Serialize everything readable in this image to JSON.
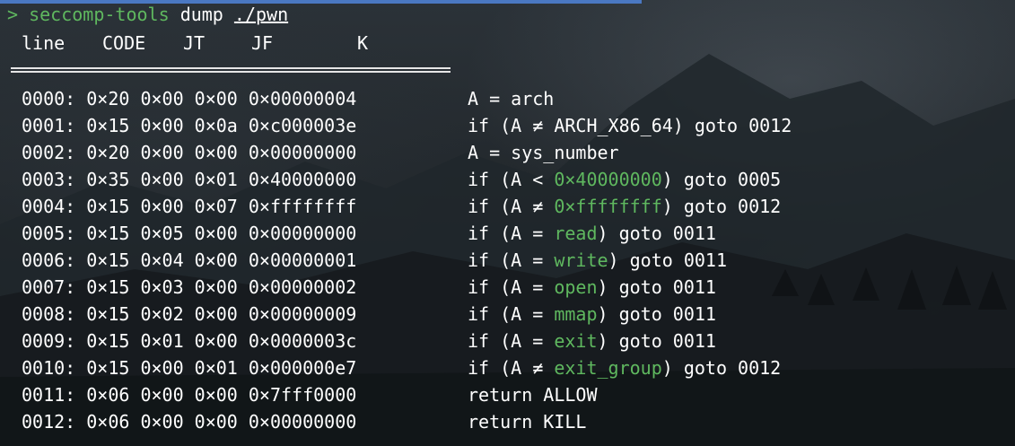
{
  "terminal": {
    "prompt_symbol": ">",
    "command_tool": "seccomp-tools",
    "command_subcommand": "dump",
    "command_path": "./pwn"
  },
  "columns": {
    "line": "line",
    "code": "CODE",
    "jt": "JT",
    "jf": "JF",
    "k": "K"
  },
  "rows": [
    {
      "disasm": "0000: 0×20 0×00 0×00 0×00000004",
      "pre": "A = arch",
      "hl": "",
      "post": ""
    },
    {
      "disasm": "0001: 0×15 0×00 0×0a 0×c000003e",
      "pre": "if (A ≠ ARCH_X86_64) goto 0012",
      "hl": "",
      "post": ""
    },
    {
      "disasm": "0002: 0×20 0×00 0×00 0×00000000",
      "pre": "A = sys_number",
      "hl": "",
      "post": ""
    },
    {
      "disasm": "0003: 0×35 0×00 0×01 0×40000000",
      "pre": "if (A < ",
      "hl": "0×40000000",
      "post": ") goto 0005"
    },
    {
      "disasm": "0004: 0×15 0×00 0×07 0×ffffffff",
      "pre": "if (A ≠ ",
      "hl": "0×ffffffff",
      "post": ") goto 0012"
    },
    {
      "disasm": "0005: 0×15 0×05 0×00 0×00000000",
      "pre": "if (A = ",
      "hl": "read",
      "post": ") goto 0011"
    },
    {
      "disasm": "0006: 0×15 0×04 0×00 0×00000001",
      "pre": "if (A = ",
      "hl": "write",
      "post": ") goto 0011"
    },
    {
      "disasm": "0007: 0×15 0×03 0×00 0×00000002",
      "pre": "if (A = ",
      "hl": "open",
      "post": ") goto 0011"
    },
    {
      "disasm": "0008: 0×15 0×02 0×00 0×00000009",
      "pre": "if (A = ",
      "hl": "mmap",
      "post": ") goto 0011"
    },
    {
      "disasm": "0009: 0×15 0×01 0×00 0×0000003c",
      "pre": "if (A = ",
      "hl": "exit",
      "post": ") goto 0011"
    },
    {
      "disasm": "0010: 0×15 0×00 0×01 0×000000e7",
      "pre": "if (A ≠ ",
      "hl": "exit_group",
      "post": ") goto 0012"
    },
    {
      "disasm": "0011: 0×06 0×00 0×00 0×7fff0000",
      "pre": "return ALLOW",
      "hl": "",
      "post": ""
    },
    {
      "disasm": "0012: 0×06 0×00 0×00 0×00000000",
      "pre": "return KILL",
      "hl": "",
      "post": ""
    }
  ],
  "colors": {
    "highlight": "#5fb85f",
    "text": "#ffffff",
    "tab_accent": "#4a78c2"
  }
}
